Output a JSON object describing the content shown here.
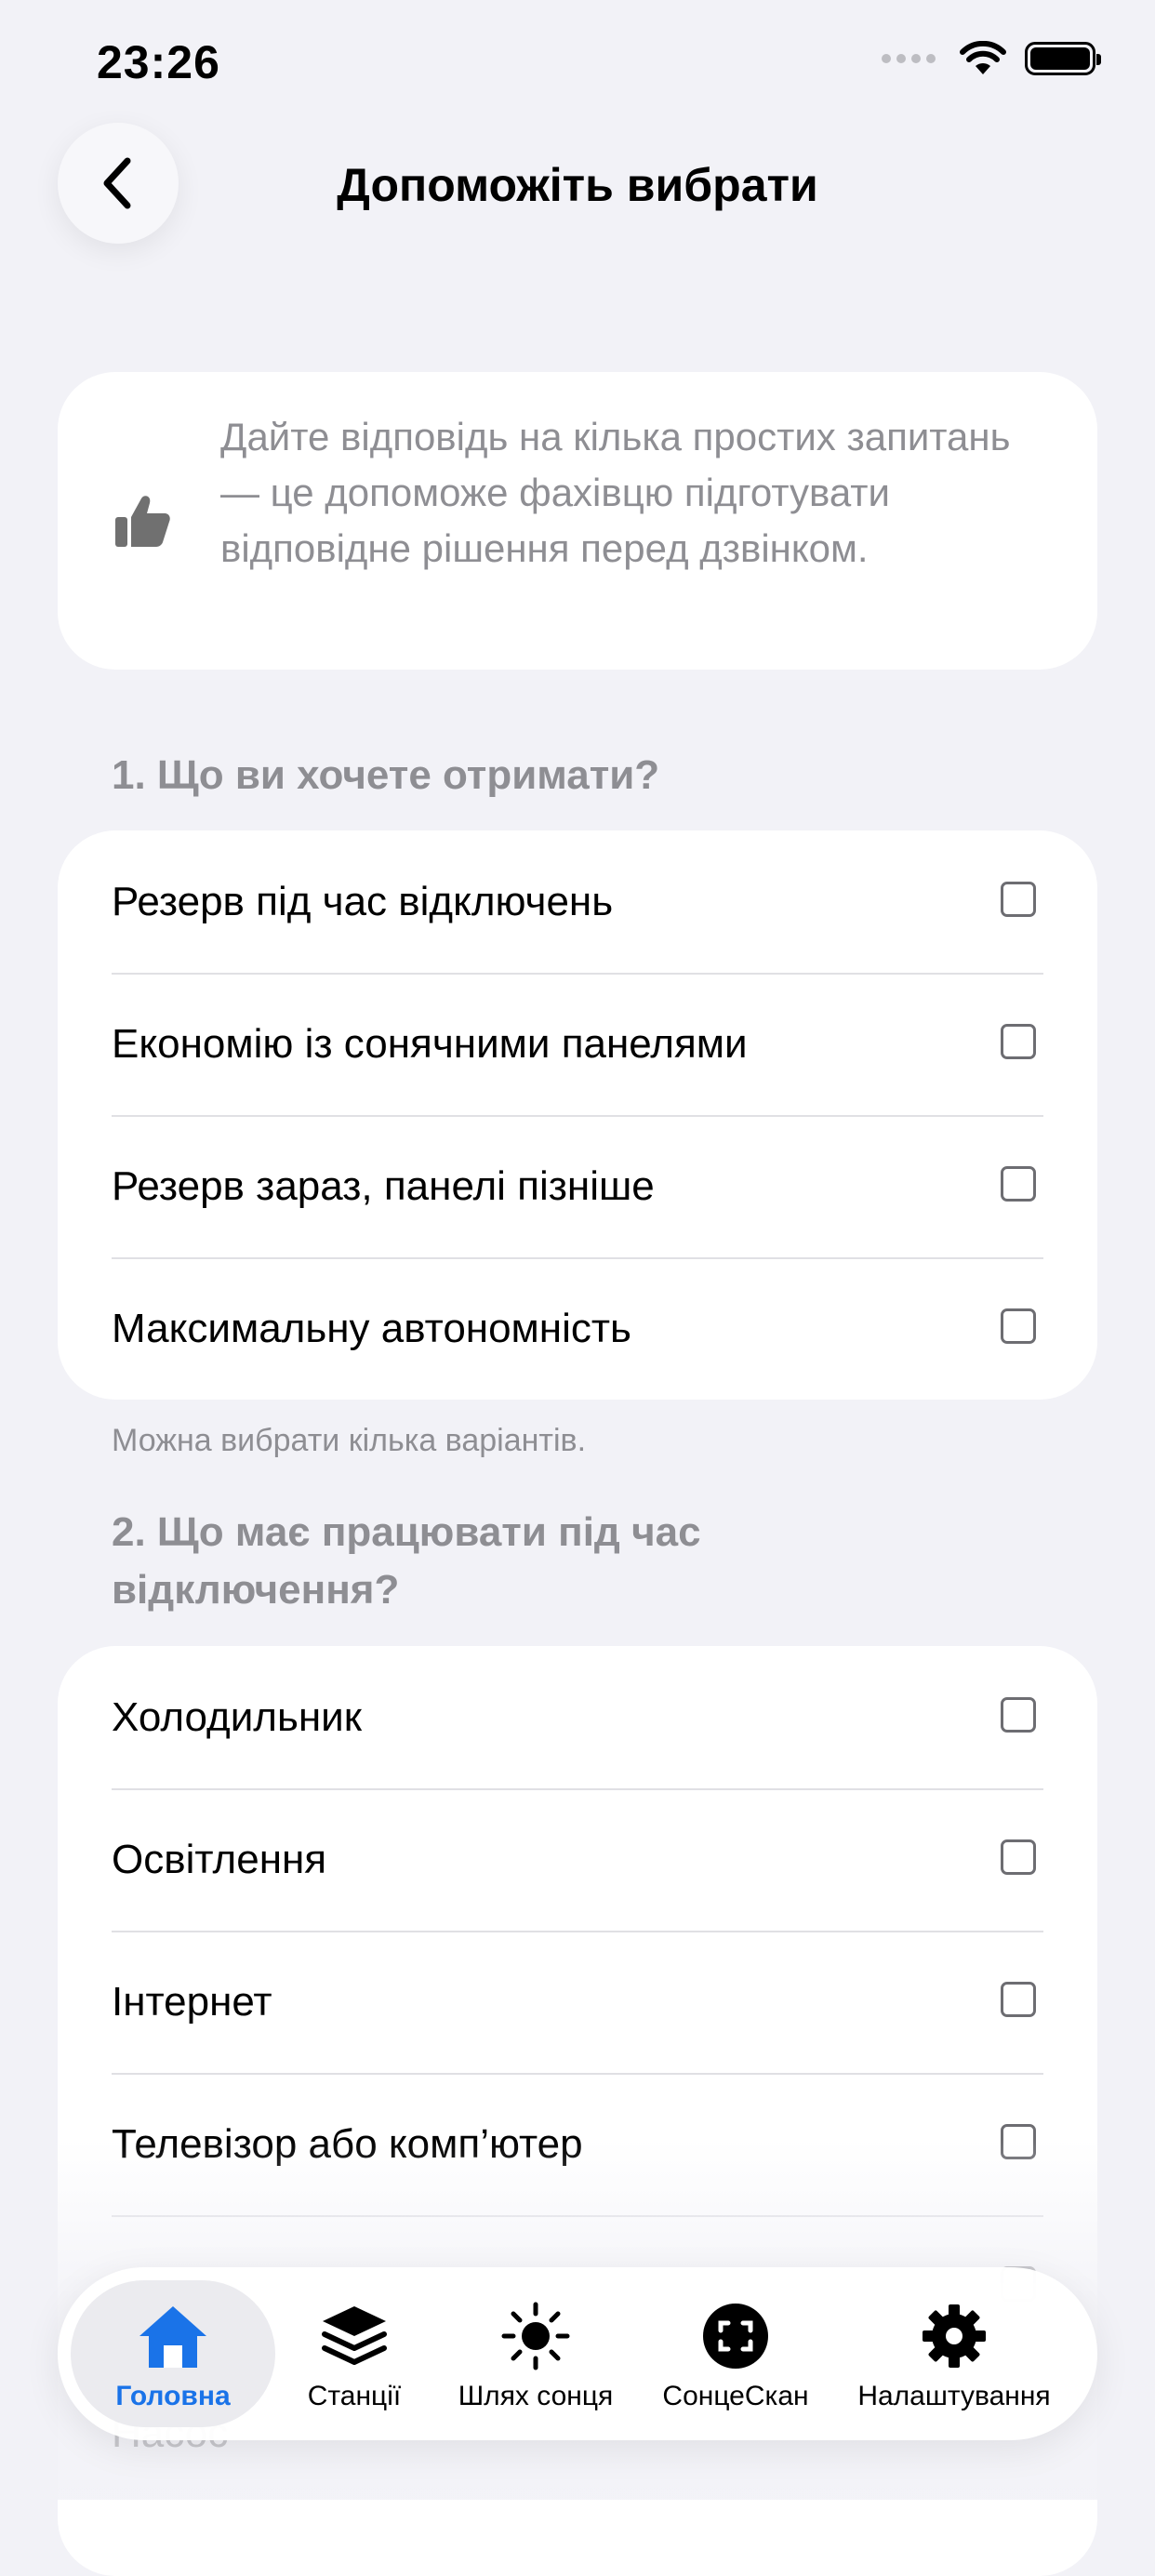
{
  "status": {
    "time": "23:26"
  },
  "header": {
    "title": "Допоможіть вибрати"
  },
  "info": {
    "text": "Дайте відповідь на кілька простих запитань — це допоможе фахівцю підготувати відповідне рішення перед дзвінком."
  },
  "q1": {
    "title": "1. Що ви хочете отримати?",
    "options": [
      "Резерв під час відключень",
      "Економію із сонячними панелями",
      "Резерв зараз, панелі пізніше",
      "Максимальну автономність"
    ],
    "hint": "Можна вибрати кілька варіантів."
  },
  "q2": {
    "title": "2. Що має працювати під час відключення?",
    "options": [
      "Холодильник",
      "Освітлення",
      "Інтернет",
      "Телевізор або комп’ютер"
    ],
    "partial": "Насос"
  },
  "tabs": [
    {
      "label": "Головна",
      "icon": "home-icon",
      "active": true
    },
    {
      "label": "Станції",
      "icon": "layers-icon"
    },
    {
      "label": "Шлях сонця",
      "icon": "sun-icon"
    },
    {
      "label": "СонцеСкан",
      "icon": "scan-icon"
    },
    {
      "label": "Налаштування",
      "icon": "gear-icon"
    }
  ],
  "colors": {
    "accent": "#1a73e8",
    "background": "#f2f2f7",
    "secondary_text": "#8e8e93"
  }
}
